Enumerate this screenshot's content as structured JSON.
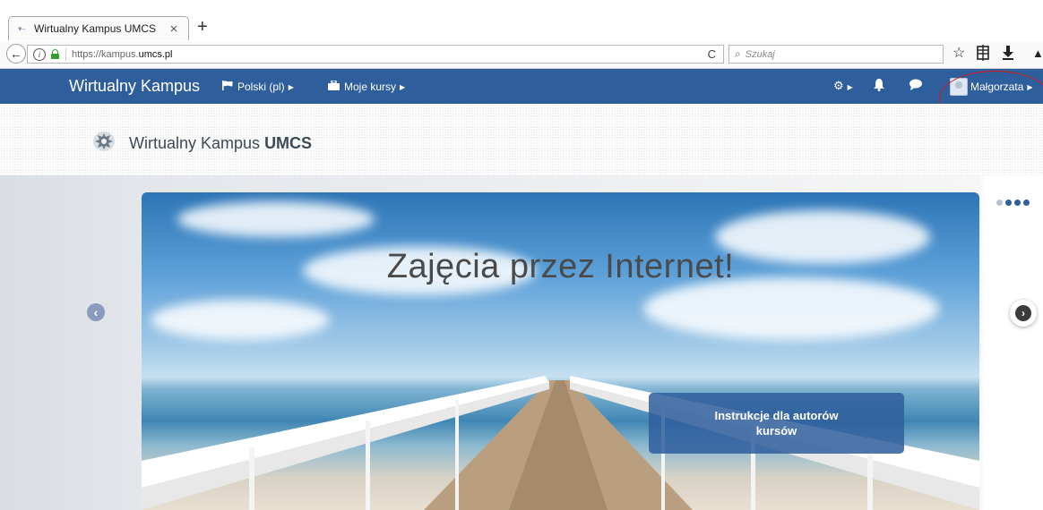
{
  "browser": {
    "tab_title": "Wirtualny Kampus UMCS",
    "tab_close": "×",
    "new_tab": "+",
    "back": "←",
    "url_prefix": "https://kampus.",
    "url_domain": "umcs.pl",
    "reload": "C",
    "search_placeholder": "Szukaj",
    "toolbar_icons": [
      "star-icon",
      "reading-list-icon",
      "download-icon"
    ]
  },
  "site_nav": {
    "brand": "Wirtualny Kampus",
    "language": "Polski (pl)",
    "courses": "Moje kursy",
    "user": "Małgorzata",
    "accent": "#2f5e9c"
  },
  "header": {
    "logo_text_regular": "Wirtualny Kampus ",
    "logo_text_bold": "UMCS"
  },
  "carousel": {
    "slide_title": "Zajęcia przez Internet!",
    "cta_label": "Instrukcje dla autorów kursów",
    "active_dot": 2,
    "dot_count": 4
  },
  "annotation": {
    "color": "#d51a1a"
  }
}
